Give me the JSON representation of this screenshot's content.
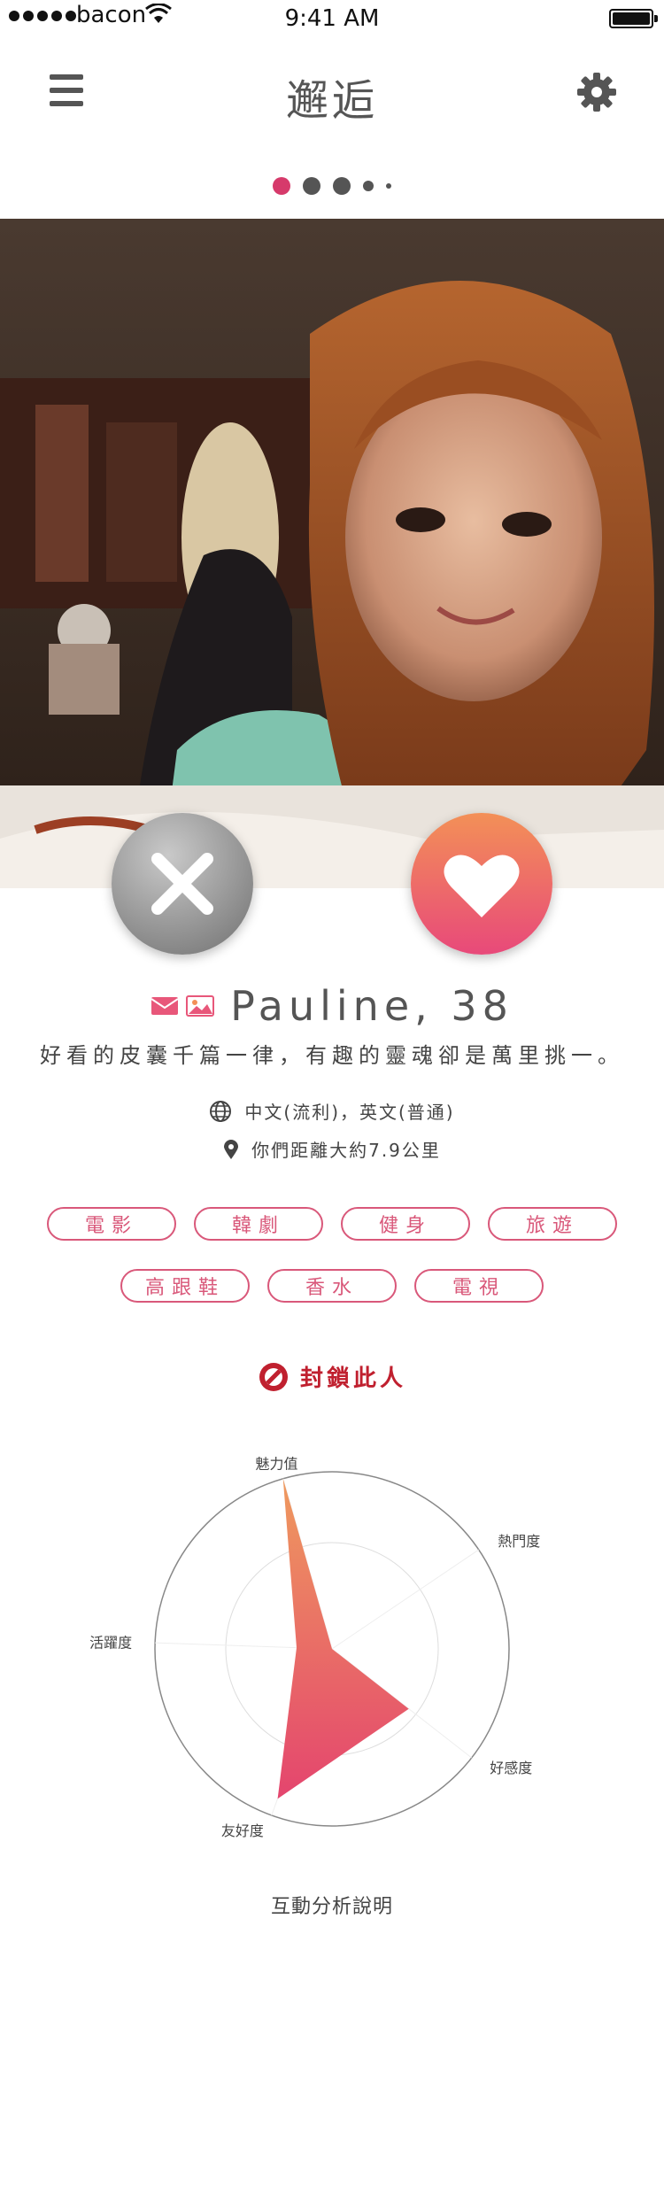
{
  "status_bar": {
    "carrier": "bacon",
    "time": "9:41 AM"
  },
  "nav": {
    "title": "邂逅",
    "menu_icon": "hamburger-icon",
    "settings_icon": "gear-icon"
  },
  "photo_indicator": {
    "count": 5,
    "active_index": 0,
    "active_color": "#d63a6b"
  },
  "actions": {
    "nope_icon": "close-icon",
    "like_icon": "heart-icon"
  },
  "profile": {
    "name_line": "Pauline, 38",
    "bio": "好看的皮囊千篇一律，有趣的靈魂卻是萬里挑一。",
    "languages": "中文(流利)，英文(普通)",
    "distance": "你們距離大約7.9公里"
  },
  "interests": {
    "row1": [
      "電影",
      "韓劇",
      "健身",
      "旅遊"
    ],
    "row2": [
      "高跟鞋",
      "香水",
      "電視"
    ]
  },
  "block": {
    "label": "封鎖此人",
    "color": "#c0202f"
  },
  "radar": {
    "axes": [
      "魅力值",
      "熱門度",
      "好感度",
      "友好度",
      "活躍度"
    ],
    "values": [
      1.0,
      0.0,
      0.55,
      0.9,
      0.2
    ],
    "gradient": [
      "#ef9a5e",
      "#e4456e"
    ]
  },
  "footer_link": "互動分析說明"
}
